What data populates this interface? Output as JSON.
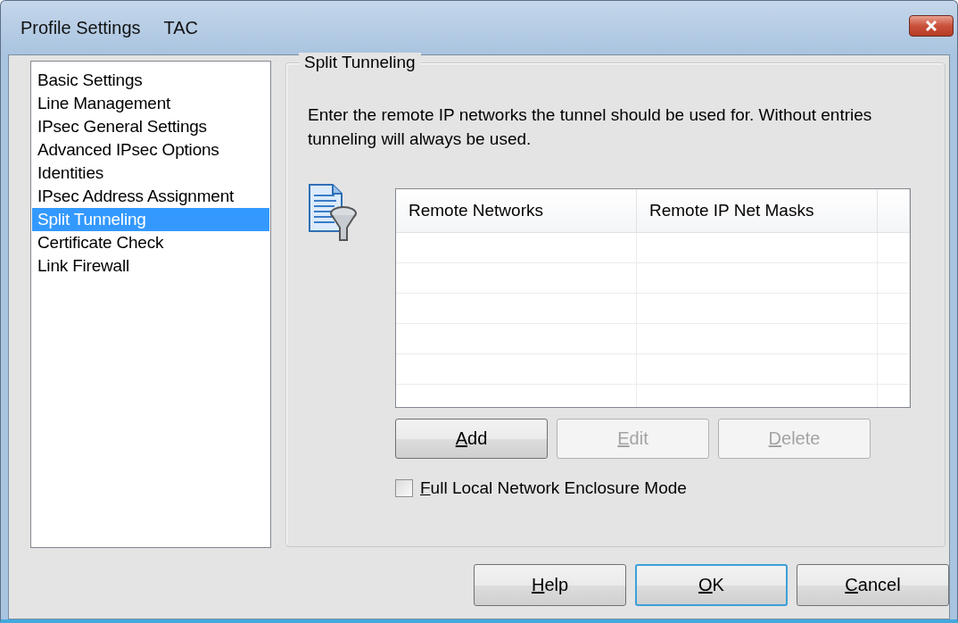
{
  "window": {
    "title": "Profile Settings",
    "subtitle": "TAC"
  },
  "sidebar": {
    "items": [
      {
        "label": "Basic Settings",
        "selected": false
      },
      {
        "label": "Line Management",
        "selected": false
      },
      {
        "label": "IPsec General Settings",
        "selected": false
      },
      {
        "label": "Advanced IPsec Options",
        "selected": false
      },
      {
        "label": "Identities",
        "selected": false
      },
      {
        "label": "IPsec Address Assignment",
        "selected": false
      },
      {
        "label": "Split Tunneling",
        "selected": true
      },
      {
        "label": "Certificate Check",
        "selected": false
      },
      {
        "label": "Link Firewall",
        "selected": false
      }
    ]
  },
  "group": {
    "title": "Split Tunneling",
    "description": "Enter the remote IP networks the tunnel should be used for. Without entries tunneling will always be used.",
    "table": {
      "columns": [
        "Remote Networks",
        "Remote IP Net Masks"
      ]
    },
    "buttons": [
      {
        "key": "A",
        "rest": "dd",
        "disabled": false
      },
      {
        "key": "E",
        "rest": "dit",
        "disabled": true
      },
      {
        "key": "D",
        "rest": "elete",
        "disabled": true
      }
    ],
    "checkbox": {
      "key": "F",
      "rest": "ull Local Network Enclosure Mode",
      "checked": false
    }
  },
  "footer_buttons": [
    {
      "key": "H",
      "rest": "elp",
      "default": false
    },
    {
      "key": "O",
      "rest": "K",
      "default": true
    },
    {
      "key": "C",
      "rest": "ancel",
      "default": false
    }
  ]
}
